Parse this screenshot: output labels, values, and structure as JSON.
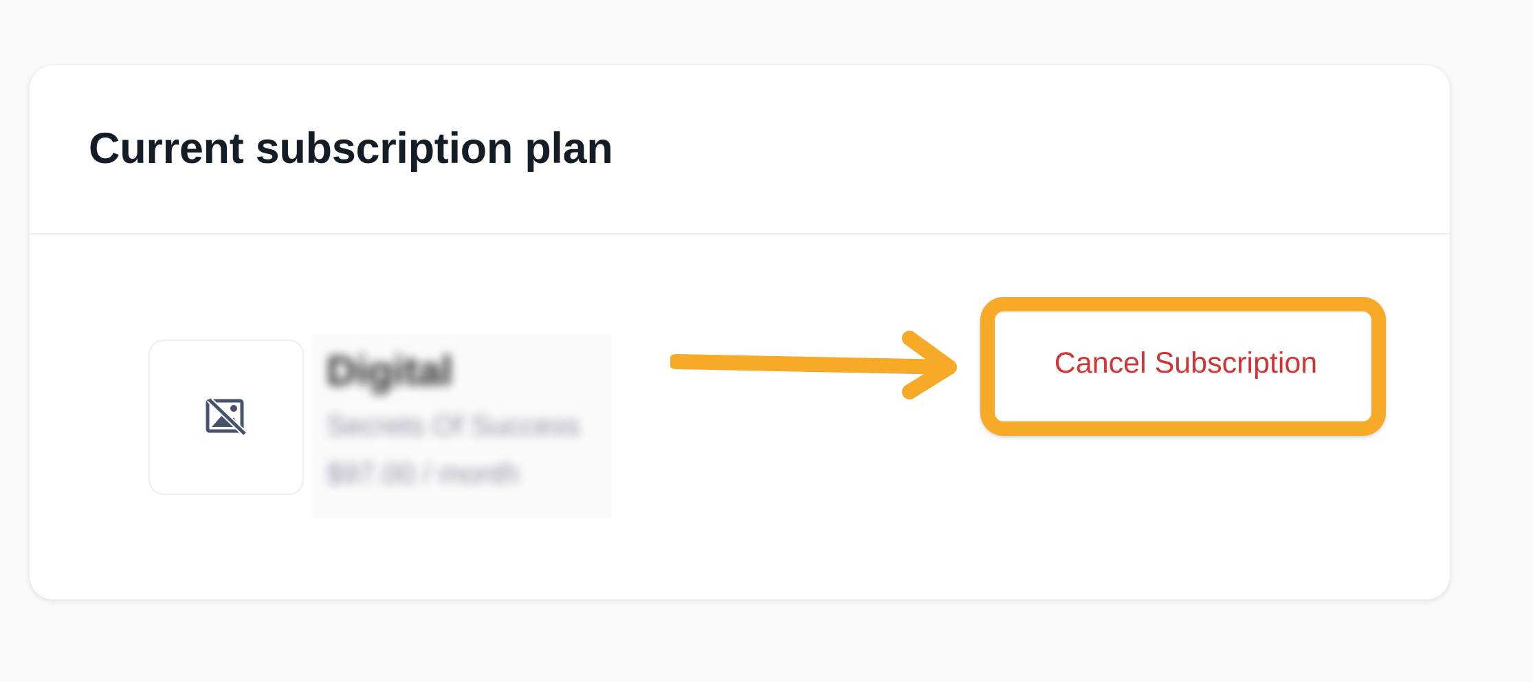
{
  "card": {
    "title": "Current subscription plan"
  },
  "plan": {
    "thumbnail_icon": "image-off-icon",
    "name": "Digital",
    "description": "Secrets Of Success",
    "price": "$97.00 / month"
  },
  "annotation": {
    "arrow_color": "#f7a928",
    "highlight_color": "#f7a928"
  },
  "actions": {
    "cancel_label": "Cancel Subscription",
    "cancel_color": "#cf3535"
  }
}
